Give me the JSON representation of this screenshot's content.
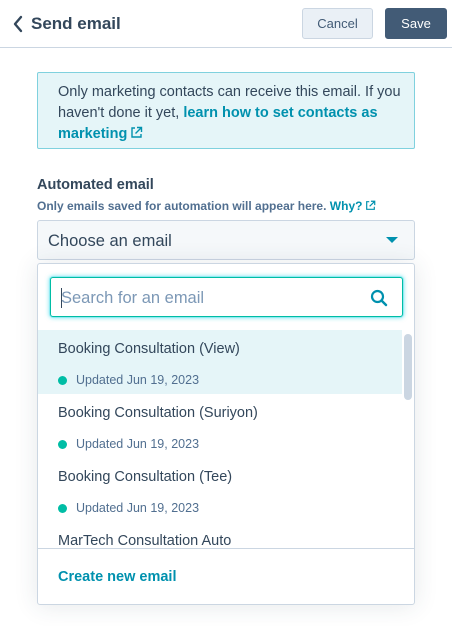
{
  "header": {
    "title": "Send email",
    "back_icon": "chevron-left-icon",
    "cancel_label": "Cancel",
    "save_label": "Save"
  },
  "alert": {
    "text": "Only marketing contacts can receive this email. If you haven't done it yet,",
    "link_text": "learn how to set contacts as marketing",
    "link_icon": "external-link-icon"
  },
  "field": {
    "label": "Automated email",
    "help_text": "Only emails saved for automation will appear here.",
    "help_link": "Why?"
  },
  "select": {
    "value": "Choose an email"
  },
  "dropdown": {
    "search_placeholder": "Search for an email",
    "search_value": "",
    "items": [
      {
        "name": "Booking Consultation (View)",
        "status": "Updated Jun 19, 2023",
        "selected": true
      },
      {
        "name": "Booking Consultation (Suriyon)",
        "status": "Updated Jun 19, 2023",
        "selected": false
      },
      {
        "name": "Booking Consultation (Tee)",
        "status": "Updated Jun 19, 2023",
        "selected": false
      },
      {
        "name": "MarTech Consultation Auto",
        "status": "",
        "selected": false
      }
    ],
    "create_label": "Create new email"
  },
  "colors": {
    "accent": "#0091ae",
    "primary_button": "#425b76",
    "status_dot": "#00bda5",
    "alert_bg": "#e5f5f8",
    "text": "#33475b"
  }
}
